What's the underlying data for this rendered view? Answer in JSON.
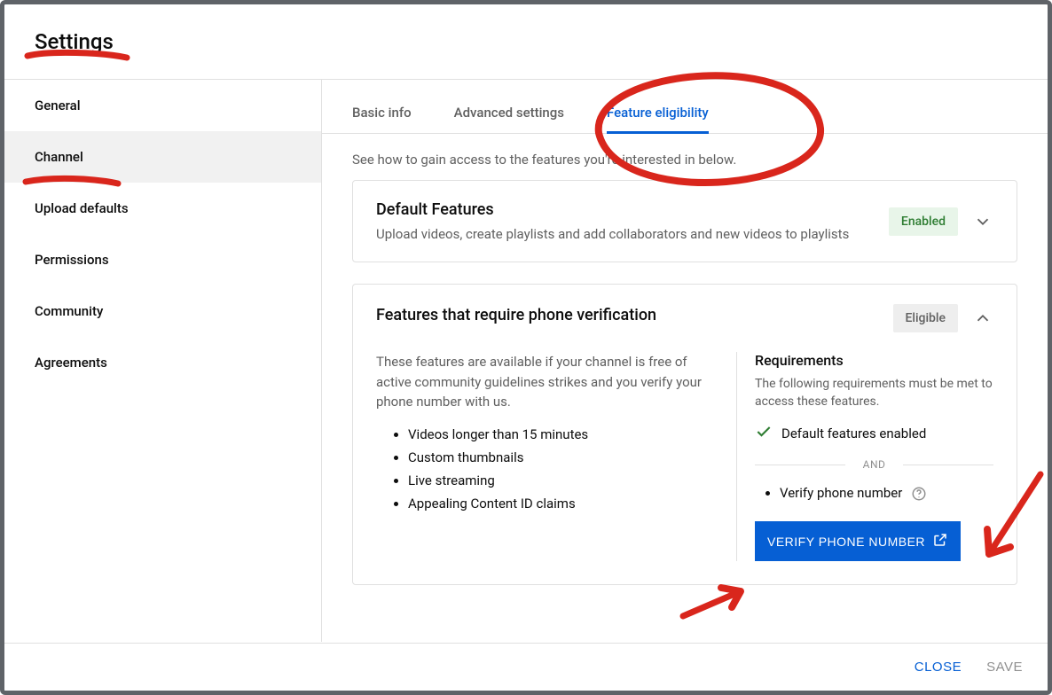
{
  "header": {
    "title": "Settings"
  },
  "sidebar": {
    "items": [
      {
        "label": "General"
      },
      {
        "label": "Channel"
      },
      {
        "label": "Upload defaults"
      },
      {
        "label": "Permissions"
      },
      {
        "label": "Community"
      },
      {
        "label": "Agreements"
      }
    ],
    "active_index": 1
  },
  "tabs": {
    "items": [
      {
        "label": "Basic info"
      },
      {
        "label": "Advanced settings"
      },
      {
        "label": "Feature eligibility"
      }
    ],
    "active_index": 2
  },
  "intro": "See how to gain access to the features you're interested in below.",
  "default_card": {
    "title": "Default Features",
    "subtitle": "Upload videos, create playlists and add collaborators and new videos to playlists",
    "badge": "Enabled"
  },
  "phone_card": {
    "title": "Features that require phone verification",
    "badge": "Eligible",
    "description": "These features are available if your channel is free of active community guidelines strikes and you verify your phone number with us.",
    "features": [
      "Videos longer than 15 minutes",
      "Custom thumbnails",
      "Live streaming",
      "Appealing Content ID claims"
    ],
    "requirements": {
      "title": "Requirements",
      "subtitle": "The following requirements must be met to access these features.",
      "done_label": "Default features enabled",
      "and_label": "AND",
      "todo_label": "Verify phone number",
      "button": "VERIFY PHONE NUMBER"
    }
  },
  "footer": {
    "close": "CLOSE",
    "save": "SAVE"
  },
  "colors": {
    "accent": "#065fd4",
    "annotation": "#d9261c"
  }
}
